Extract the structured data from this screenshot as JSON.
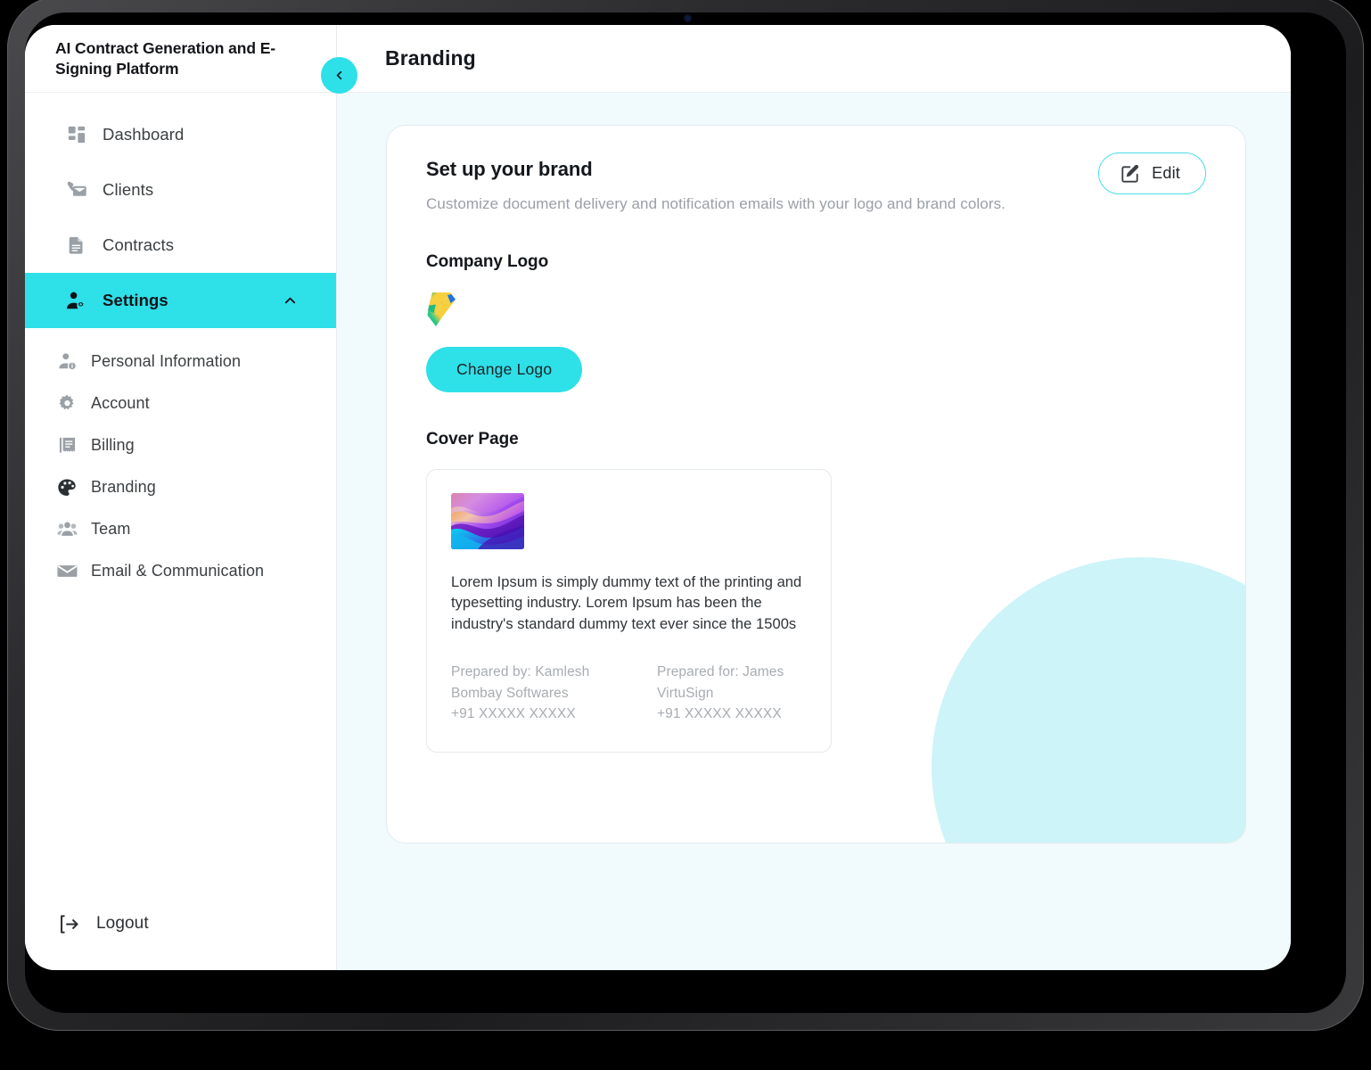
{
  "app": {
    "title": "AI Contract Generation and E-Signing Platform",
    "collapse_icon": "chevron-left-icon"
  },
  "sidebar": {
    "items": [
      {
        "label": "Dashboard",
        "icon": "dashboard-grid-icon",
        "active": false
      },
      {
        "label": "Clients",
        "icon": "clients-mail-icon",
        "active": false
      },
      {
        "label": "Contracts",
        "icon": "document-icon",
        "active": false
      },
      {
        "label": "Settings",
        "icon": "user-settings-icon",
        "active": true,
        "expanded": true,
        "chevron": "chevron-up-icon"
      }
    ],
    "sub_items": [
      {
        "label": "Personal Information",
        "icon": "user-info-icon",
        "current": false
      },
      {
        "label": "Account",
        "icon": "gear-icon",
        "current": false
      },
      {
        "label": "Billing",
        "icon": "receipt-icon",
        "current": false
      },
      {
        "label": "Branding",
        "icon": "palette-icon",
        "current": true
      },
      {
        "label": "Team",
        "icon": "team-users-icon",
        "current": false
      },
      {
        "label": "Email & Communication",
        "icon": "envelope-icon",
        "current": false
      }
    ],
    "logout": {
      "label": "Logout",
      "icon": "logout-icon"
    }
  },
  "header": {
    "page_title": "Branding"
  },
  "brand_card": {
    "title": "Set up your brand",
    "subtitle": "Customize document delivery and notification emails with your logo and brand colors.",
    "edit_button": {
      "label": "Edit",
      "icon": "edit-pencil-icon"
    },
    "logo_section": {
      "title": "Company Logo",
      "logo_alt": "company-logo-mark",
      "change_button": "Change Logo"
    },
    "cover_section": {
      "title": "Cover Page",
      "thumbnail_alt": "cover-gradient-thumbnail",
      "body_text": "Lorem Ipsum is simply dummy text of the printing and typesetting industry. Lorem Ipsum has been the industry's standard dummy text ever since the 1500s",
      "prepared_by": {
        "name": "Prepared by: Kamlesh",
        "company": "Bombay Softwares",
        "phone": "+91 XXXXX XXXXX"
      },
      "prepared_for": {
        "name": "Prepared for: James",
        "company": "VirtuSign",
        "phone": "+91 XXXXX XXXXX"
      }
    }
  },
  "colors": {
    "accent": "#2ee0e8",
    "accent_border": "#49dde8",
    "main_bg": "#f1fbfd",
    "deco_circle": "#cdf4f8",
    "text_dark": "#14171b",
    "text_muted": "#9a9fa6"
  }
}
